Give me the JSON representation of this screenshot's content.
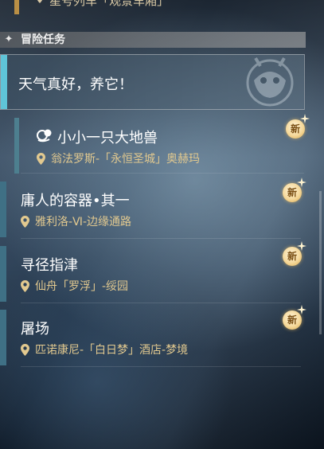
{
  "top_partial": {
    "text": "星号列车「观景车厢」"
  },
  "section": {
    "title": "冒险任务"
  },
  "selected_task": {
    "title": "天气真好，养它！"
  },
  "sub_task": {
    "title": "小小一只大地兽",
    "location": "翁法罗斯-「永恒圣城」奥赫玛",
    "badge": "新"
  },
  "tasks": [
    {
      "title": "庸人的容器•其一",
      "location": "雅利洛-Ⅵ-边缘通路",
      "badge": "新"
    },
    {
      "title": "寻径指津",
      "location": "仙舟「罗浮」-绥园",
      "badge": "新"
    },
    {
      "title": "屠场",
      "location": "匹诺康尼-「白日梦」酒店-梦境",
      "badge": "新"
    }
  ],
  "colors": {
    "accent_selected": "#5fc4d8",
    "location_text": "#e2c98f",
    "badge": "#f5d89a"
  }
}
